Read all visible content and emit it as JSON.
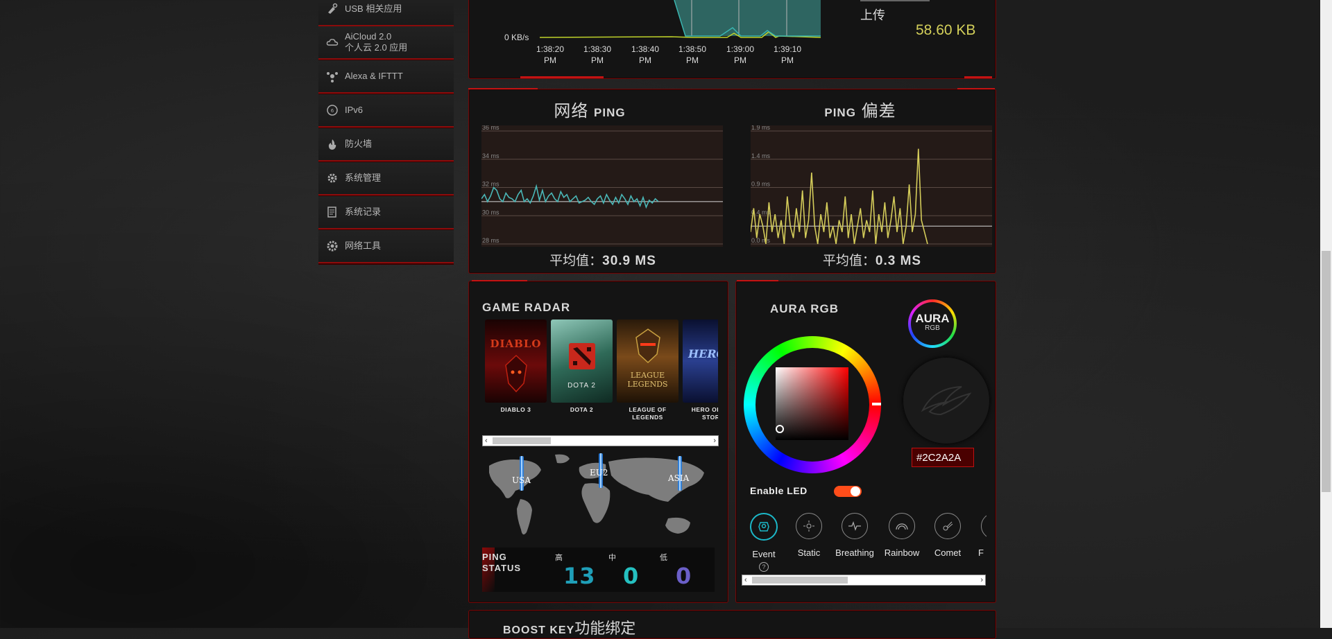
{
  "sidebar": {
    "items": [
      {
        "label": "USB 相关应用",
        "icon": "usb-app-icon"
      },
      {
        "label": "AiCloud 2.0",
        "sub": "个人云 2.0 应用",
        "icon": "cloud-icon"
      },
      {
        "label": "Alexa & IFTTT",
        "icon": "alexa-icon"
      },
      {
        "label": "IPv6",
        "icon": "globe-icon"
      },
      {
        "label": "防火墙",
        "icon": "firewall-icon"
      },
      {
        "label": "系统管理",
        "icon": "gear-icon"
      },
      {
        "label": "系统记录",
        "icon": "log-icon"
      },
      {
        "label": "网络工具",
        "icon": "tools-icon"
      }
    ]
  },
  "traffic": {
    "ylabel": "0 KB/s",
    "xticks": [
      "1:38:20 PM",
      "1:38:30 PM",
      "1:38:40 PM",
      "1:38:50 PM",
      "1:39:00 PM",
      "1:39:10 PM"
    ],
    "upload_label": "上传",
    "upload_value": "58.60 KB"
  },
  "ping_panel": {
    "title_cn": "网络",
    "title_en": "PING",
    "avg_label": "平均值：",
    "avg_value": "30.9 MS"
  },
  "jitter_panel": {
    "title_en": "PING",
    "title_cn": "偏差",
    "avg_label": "平均值：",
    "avg_value": "0.3 MS"
  },
  "chart_data": [
    {
      "type": "line",
      "title": "网络 PING",
      "yticks": [
        "36 ms",
        "34 ms",
        "32 ms",
        "30 ms",
        "28 ms"
      ],
      "ylim": [
        28,
        36
      ],
      "y": [
        31.2,
        31.5,
        31.0,
        31.4,
        32.0,
        31.8,
        31.2,
        31.0,
        31.6,
        31.3,
        31.2,
        31.0,
        31.5,
        31.8,
        31.0,
        31.2,
        30.9,
        31.4,
        32.1,
        31.1,
        31.8,
        31.0,
        31.4,
        31.6,
        31.2,
        31.0,
        31.7,
        31.3,
        31.5,
        31.0,
        31.2,
        31.4,
        30.9,
        31.0,
        31.1,
        31.3,
        31.0,
        30.8,
        31.2,
        31.4,
        30.9,
        31.5,
        31.1,
        30.8,
        31.3,
        30.9,
        31.5,
        31.2,
        30.8,
        31.4,
        31.0,
        31.2,
        30.7,
        31.3,
        30.6,
        31.1,
        30.9,
        31.2,
        31.0
      ],
      "reference": 31.0
    },
    {
      "type": "line",
      "title": "PING 偏差",
      "yticks": [
        "1.9 ms",
        "1.4 ms",
        "0.9 ms",
        "0.4 ms",
        "0.0 ms"
      ],
      "ylim": [
        0,
        1.9
      ],
      "y": [
        0.2,
        0.6,
        0.1,
        0.5,
        0.3,
        0.0,
        0.7,
        0.2,
        0.5,
        0.1,
        0.4,
        0.0,
        0.8,
        0.3,
        0.1,
        0.6,
        0.2,
        0.9,
        0.1,
        0.4,
        1.2,
        0.3,
        0.0,
        0.5,
        0.2,
        0.7,
        0.1,
        0.3,
        0.0,
        0.4,
        0.2,
        0.8,
        0.1,
        0.5,
        0.0,
        0.3,
        0.6,
        0.1,
        0.4,
        0.2,
        0.9,
        0.0,
        0.5,
        0.2,
        0.7,
        0.1,
        0.4,
        0.8,
        0.2,
        0.6,
        0.0,
        0.3,
        1.0,
        0.2,
        0.5,
        1.6,
        0.4,
        0.2,
        0.0
      ],
      "reference": 0.3
    }
  ],
  "game_radar": {
    "title": "GAME RADAR",
    "games": [
      {
        "name": "DIABLO 3",
        "art": "diablo-cover",
        "color": "#8a1010"
      },
      {
        "name": "DOTA 2",
        "art": "dota-cover",
        "color": "#2f6a58"
      },
      {
        "name": "LEAGUE OF LEGENDS",
        "art": "lol-cover",
        "color": "#7a4a1a"
      },
      {
        "name": "HERO OF THE STORM",
        "art": "heroes-cover",
        "color": "#2a3f8f"
      }
    ],
    "map_labels": [
      "USA",
      "EU2",
      "ASIA"
    ],
    "status_label": "PING STATUS",
    "levels": [
      {
        "label": "高",
        "count": "13",
        "color": "#1f9fb8"
      },
      {
        "label": "中",
        "count": "0",
        "color": "#25c0c0"
      },
      {
        "label": "低",
        "count": "0",
        "color": "#6b5fc8"
      }
    ]
  },
  "aura": {
    "title": "AURA RGB",
    "logo_text": "AURA",
    "logo_sub": "RGB",
    "color_hex": "#2C2A2A",
    "enable_label": "Enable LED",
    "enabled": true,
    "effects": [
      "Event",
      "Static",
      "Breathing",
      "Rainbow",
      "Comet",
      "F"
    ],
    "help": "?"
  },
  "boost_key": {
    "title_en": "BOOST KEY",
    "title_cn": "功能绑定"
  }
}
